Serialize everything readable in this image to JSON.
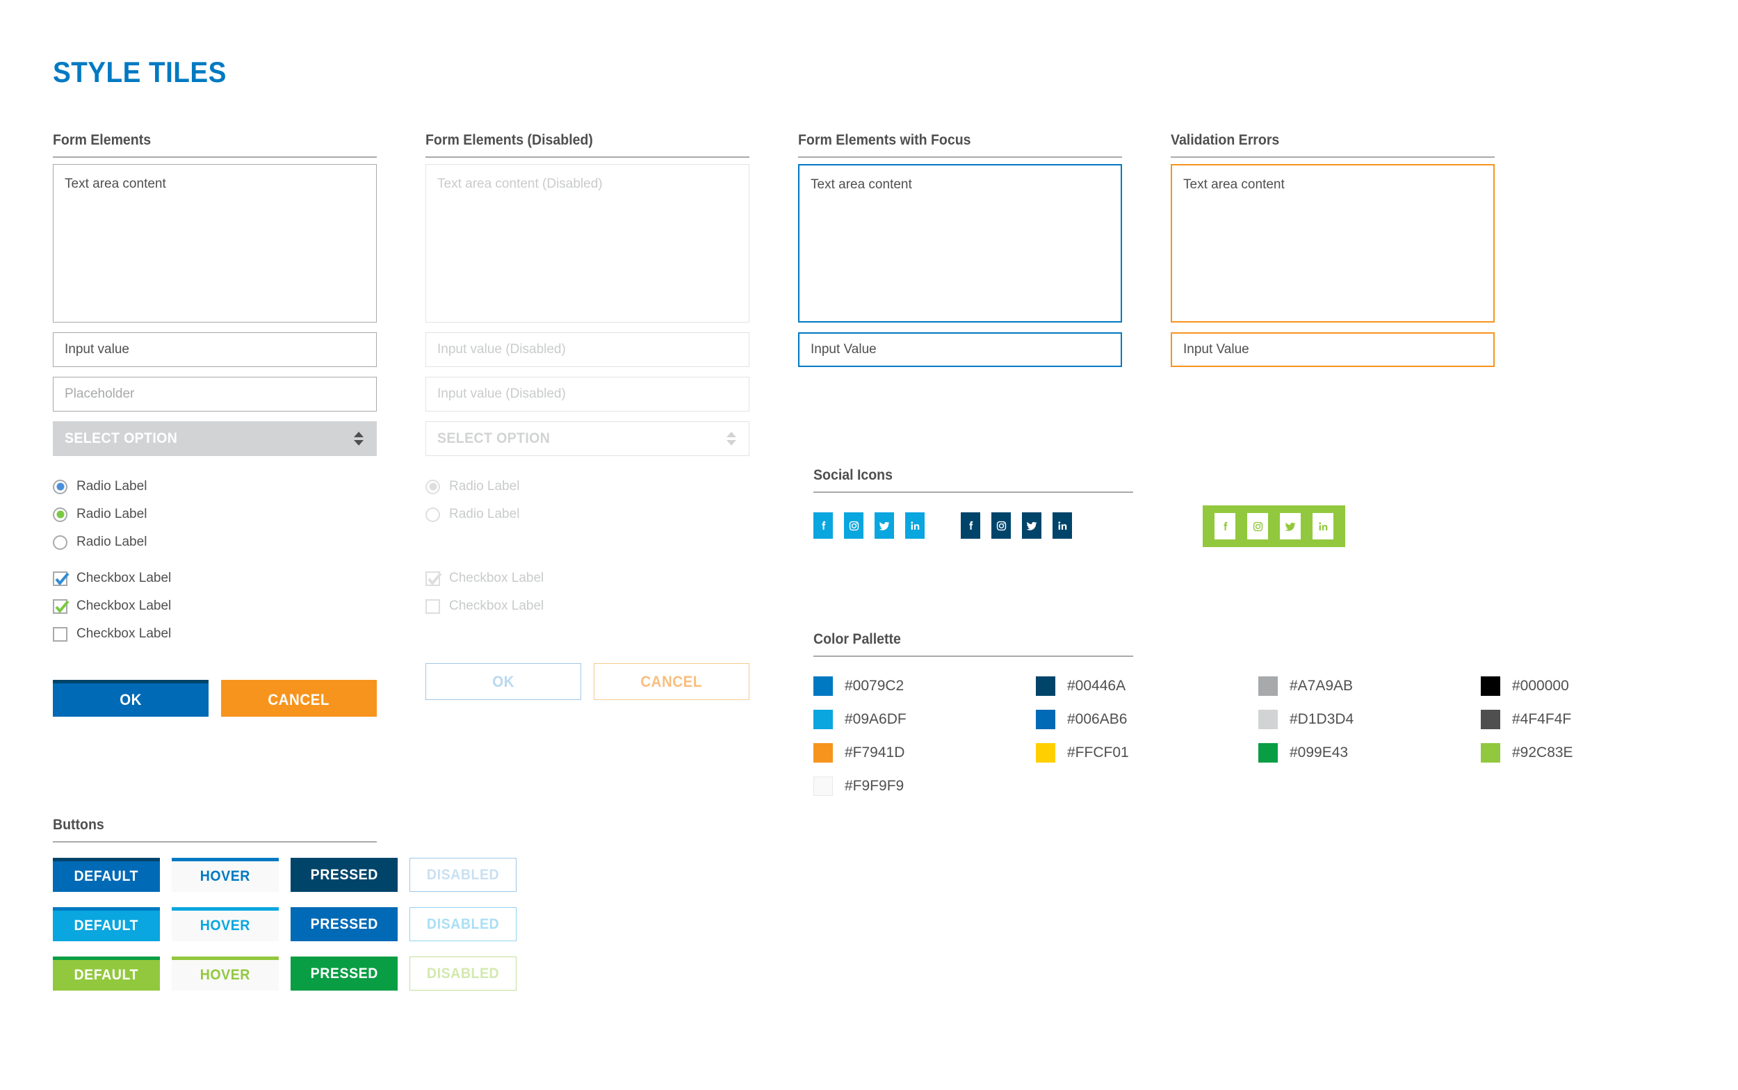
{
  "page": {
    "title": "STYLE TILES"
  },
  "sections": {
    "form": "Form Elements",
    "form_disabled": "Form Elements (Disabled)",
    "form_focus": "Form Elements with Focus",
    "validation": "Validation Errors",
    "social": "Social Icons",
    "palette": "Color Pallette",
    "buttons": "Buttons"
  },
  "form": {
    "textarea_value": "Text area content",
    "input_value": "Input value",
    "placeholder": "Placeholder",
    "select_label": "SELECT OPTION",
    "radios": [
      {
        "label": "Radio Label",
        "checked": true,
        "color": "#4A90D9"
      },
      {
        "label": "Radio Label",
        "checked": true,
        "color": "#7AC943"
      },
      {
        "label": "Radio Label",
        "checked": false,
        "color": ""
      }
    ],
    "checkboxes": [
      {
        "label": "Checkbox Label",
        "checked": true,
        "color": "#2E8BD6"
      },
      {
        "label": "Checkbox Label",
        "checked": true,
        "color": "#7AC943"
      },
      {
        "label": "Checkbox Label",
        "checked": false,
        "color": ""
      }
    ],
    "ok_label": "OK",
    "cancel_label": "CANCEL"
  },
  "form_disabled": {
    "textarea_placeholder": "Text area content (Disabled)",
    "input_placeholder_1": "Input value (Disabled)",
    "input_placeholder_2": "Input value (Disabled)",
    "select_label": "SELECT OPTION",
    "radios": [
      {
        "label": "Radio Label",
        "checked": true
      },
      {
        "label": "Radio Label",
        "checked": false
      }
    ],
    "checkboxes": [
      {
        "label": "Checkbox Label",
        "checked": true
      },
      {
        "label": "Checkbox Label",
        "checked": false
      }
    ],
    "ok_label": "OK",
    "cancel_label": "CANCEL"
  },
  "form_focus": {
    "textarea_value": "Text area content",
    "input_value": "Input Value"
  },
  "validation": {
    "textarea_value": "Text area content",
    "input_value": "Input Value"
  },
  "social": {
    "groups": [
      {
        "style": "light-blue",
        "tile_bg": "#09A6DF",
        "glyph": "#FFFFFF",
        "icons": [
          "facebook-icon",
          "instagram-icon",
          "twitter-icon",
          "linkedin-icon"
        ]
      },
      {
        "style": "dark-blue",
        "tile_bg": "#00446A",
        "glyph": "#FFFFFF",
        "icons": [
          "facebook-icon",
          "instagram-icon",
          "twitter-icon",
          "linkedin-icon"
        ]
      },
      {
        "style": "green-panel",
        "tile_bg": "#FFFFFF",
        "glyph": "#92C83E",
        "panel_bg": "#92C83E",
        "icons": [
          "facebook-icon",
          "instagram-icon",
          "twitter-icon",
          "linkedin-icon"
        ]
      }
    ]
  },
  "palette": [
    {
      "hex": "#0079C2",
      "label": "#0079C2"
    },
    {
      "hex": "#00446A",
      "label": "#00446A"
    },
    {
      "hex": "#A7A9AB",
      "label": "#A7A9AB"
    },
    {
      "hex": "#000000",
      "label": "#000000"
    },
    {
      "hex": "#09A6DF",
      "label": "#09A6DF"
    },
    {
      "hex": "#006AB6",
      "label": "#006AB6"
    },
    {
      "hex": "#D1D3D4",
      "label": "#D1D3D4"
    },
    {
      "hex": "#4F4F4F",
      "label": "#4F4F4F"
    },
    {
      "hex": "#F7941D",
      "label": "#F7941D"
    },
    {
      "hex": "#FFCF01",
      "label": "#FFCF01"
    },
    {
      "hex": "#099E43",
      "label": "#099E43"
    },
    {
      "hex": "#92C83E",
      "label": "#92C83E"
    },
    {
      "hex": "#F9F9F9",
      "label": "#F9F9F9"
    }
  ],
  "buttons": {
    "labels": {
      "default": "DEFAULT",
      "hover": "HOVER",
      "pressed": "PRESSED",
      "disabled": "DISABLED"
    },
    "rows": [
      {
        "default_bg": "#006AB6",
        "default_top": "#00446A",
        "hover_text": "#0079C2",
        "hover_top": "#0079C2",
        "pressed_bg": "#00446A",
        "disabled_text": "#C9E0F2",
        "disabled_border": "#9EC8E8"
      },
      {
        "default_bg": "#09A6DF",
        "default_top": "#0079C2",
        "hover_text": "#09A6DF",
        "hover_top": "#09A6DF",
        "pressed_bg": "#006AB6",
        "disabled_text": "#A9DFF5",
        "disabled_border": "#8FD4F0"
      },
      {
        "default_bg": "#92C83E",
        "default_top": "#099E43",
        "hover_text": "#92C83E",
        "hover_top": "#92C83E",
        "pressed_bg": "#099E43",
        "disabled_text": "#D3E9AE",
        "disabled_border": "#C3E09A"
      }
    ]
  }
}
